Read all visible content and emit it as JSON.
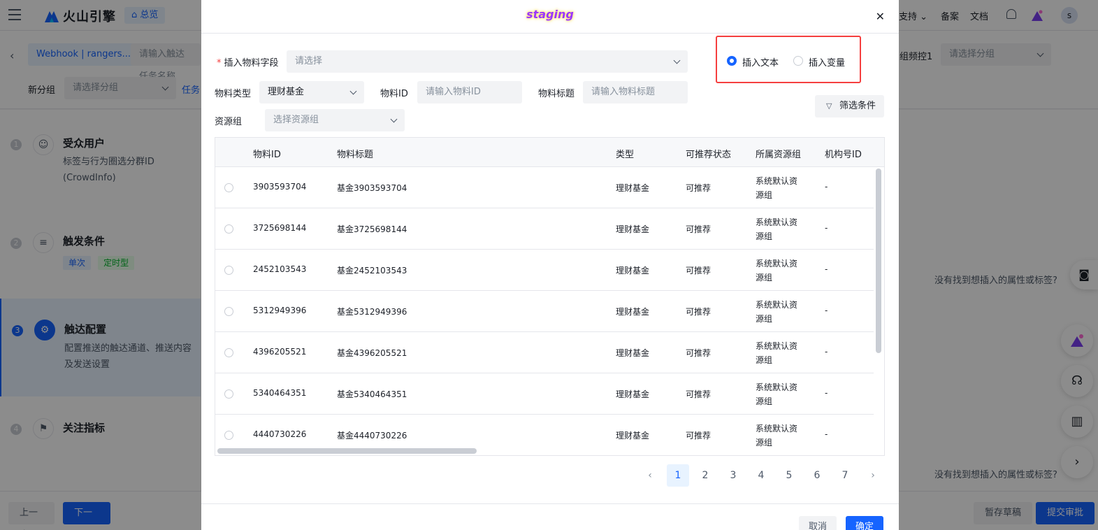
{
  "app": {
    "logo_text": "火山引擎",
    "home_tag": "总览"
  },
  "top_nav": [
    "支持",
    "备案",
    "文档"
  ],
  "user_initial": "s",
  "header": {
    "webhook_tag": "Webhook | rangers...",
    "task_name_placeholder": "请输入触达任务名称",
    "group_freq_label": "组频控1",
    "group_select_placeholder": "请选择分组",
    "new_group_label": "新分组",
    "new_group_placeholder": "请选择分组",
    "task_link": "任务"
  },
  "steps": [
    {
      "num": "1",
      "icon": "user-icon",
      "title": "受众用户",
      "desc": "标签与行为圈选分群ID (CrowdInfo)"
    },
    {
      "num": "2",
      "icon": "list-icon",
      "title": "触发条件",
      "tags": [
        "单次",
        "定时型"
      ]
    },
    {
      "num": "3",
      "icon": "gear-icon",
      "title": "触达配置",
      "desc": "配置推送的触达通道、推送内容及发送设置"
    },
    {
      "num": "4",
      "icon": "flag-icon",
      "title": "关注指标"
    }
  ],
  "right_hints": [
    "没有找到想插入的属性或标签?",
    "没有找到想插入的属性或标签?"
  ],
  "footer": {
    "prev": "上一步",
    "next": "下一步",
    "save_draft": "暂存草稿",
    "submit": "提交审批"
  },
  "modal": {
    "env_badge": "staging",
    "field_label": "插入物料字段",
    "field_placeholder": "请选择",
    "radio_text": "插入文本",
    "radio_variable": "插入变量",
    "type_label": "物料类型",
    "type_value": "理财基金",
    "id_label": "物料ID",
    "id_placeholder": "请输入物料ID",
    "title_label": "物料标题",
    "title_placeholder": "请输入物料标题",
    "group_label": "资源组",
    "group_placeholder": "选择资源组",
    "filter_button": "筛选条件",
    "columns": [
      "物料ID",
      "物料标题",
      "类型",
      "可推荐状态",
      "所属资源组",
      "机构号ID"
    ],
    "rows": [
      {
        "id": "3903593704",
        "title": "基金3903593704",
        "type": "理财基金",
        "status": "可推荐",
        "group": "系统默认资源组",
        "org": "-"
      },
      {
        "id": "3725698144",
        "title": "基金3725698144",
        "type": "理财基金",
        "status": "可推荐",
        "group": "系统默认资源组",
        "org": "-"
      },
      {
        "id": "2452103543",
        "title": "基金2452103543",
        "type": "理财基金",
        "status": "可推荐",
        "group": "系统默认资源组",
        "org": "-"
      },
      {
        "id": "5312949396",
        "title": "基金5312949396",
        "type": "理财基金",
        "status": "可推荐",
        "group": "系统默认资源组",
        "org": "-"
      },
      {
        "id": "4396205521",
        "title": "基金4396205521",
        "type": "理财基金",
        "status": "可推荐",
        "group": "系统默认资源组",
        "org": "-"
      },
      {
        "id": "5340464351",
        "title": "基金5340464351",
        "type": "理财基金",
        "status": "可推荐",
        "group": "系统默认资源组",
        "org": "-"
      },
      {
        "id": "4440730226",
        "title": "基金4440730226",
        "type": "理财基金",
        "status": "可推荐",
        "group": "系统默认资源组",
        "org": "-"
      }
    ],
    "pages": [
      "1",
      "2",
      "3",
      "4",
      "5",
      "6",
      "7"
    ],
    "current_page": "1",
    "cancel": "取消",
    "confirm": "确定"
  },
  "colors": {
    "primary": "#1664ff",
    "highlight_border": "#f53f3f",
    "env_badge": "#9b37ff"
  }
}
